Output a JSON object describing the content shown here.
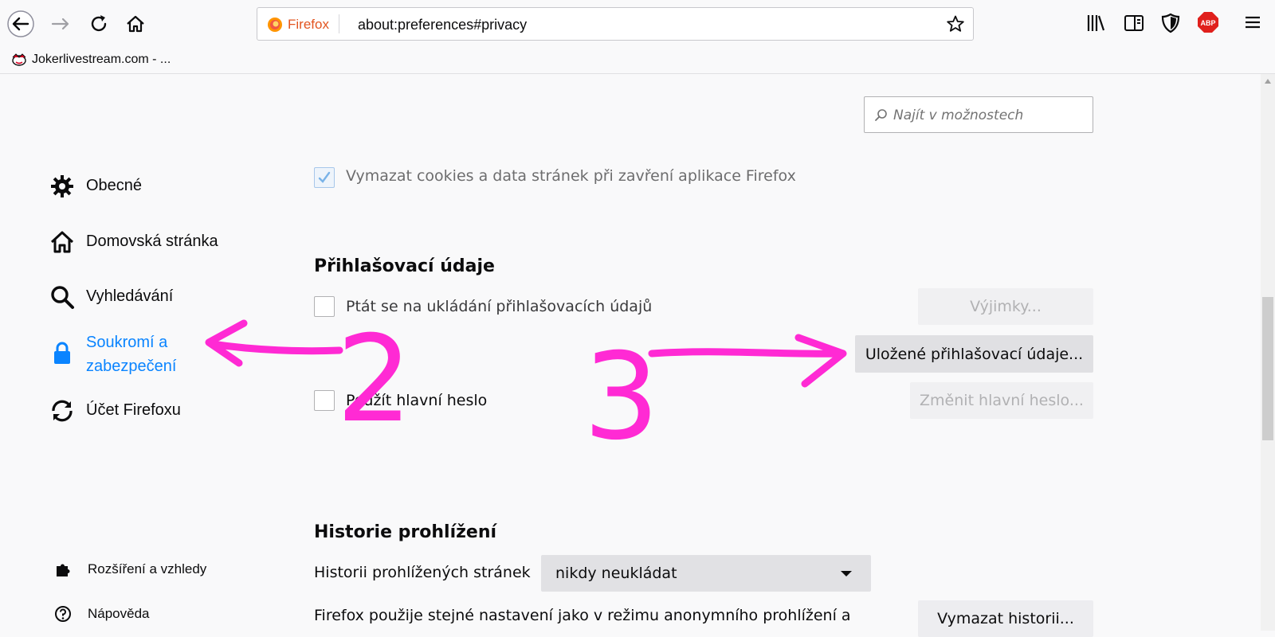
{
  "browser": {
    "url_badge": "Firefox",
    "url": "about:preferences#privacy",
    "bookmark": "Jokerlivestream.com - ...",
    "icons": [
      "back-icon",
      "forward-icon",
      "reload-icon",
      "home-icon",
      "firefox-logo-icon",
      "bookmark-star-icon",
      "library-icon",
      "sidebar-icon",
      "shield-icon",
      "adblock-icon",
      "menu-icon"
    ],
    "adblock_label": "ABP"
  },
  "search": {
    "placeholder": "Najít v možnostech"
  },
  "sidebar": {
    "items": [
      {
        "label": "Obecné",
        "icon": "gear-icon"
      },
      {
        "label": "Domovská stránka",
        "icon": "home-icon"
      },
      {
        "label": "Vyhledávání",
        "icon": "search-icon"
      },
      {
        "label_line1": "Soukromí a",
        "label_line2": "zabezpečení",
        "icon": "lock-icon",
        "selected": true
      },
      {
        "label": "Účet Firefoxu",
        "icon": "sync-icon"
      }
    ],
    "footer": [
      {
        "label": "Rozšíření a vzhledy",
        "icon": "puzzle-icon"
      },
      {
        "label": "Nápověda",
        "icon": "help-icon"
      }
    ]
  },
  "content": {
    "cookies_checkbox": {
      "label": "Vymazat cookies a data stránek při zavření aplikace Firefox",
      "checked": true
    },
    "logins": {
      "heading": "Přihlašovací údaje",
      "ask_label": "Ptát se na ukládání přihlašovacích údajů",
      "exceptions_button": "Výjimky...",
      "saved_button": "Uložené přihlašovací údaje...",
      "master_label": "Použít hlavní heslo",
      "change_master_button": "Změnit hlavní heslo..."
    },
    "history": {
      "heading": "Historie prohlížení",
      "select_label": "Historii prohlížených stránek",
      "select_value": "nikdy neukládat",
      "note": "Firefox použije stejné nastavení jako v režimu anonymního prohlížení a",
      "clear_button": "Vymazat historii..."
    }
  },
  "annotations": {
    "color": "#ff2ad4",
    "label_2": "2",
    "label_3": "3"
  }
}
